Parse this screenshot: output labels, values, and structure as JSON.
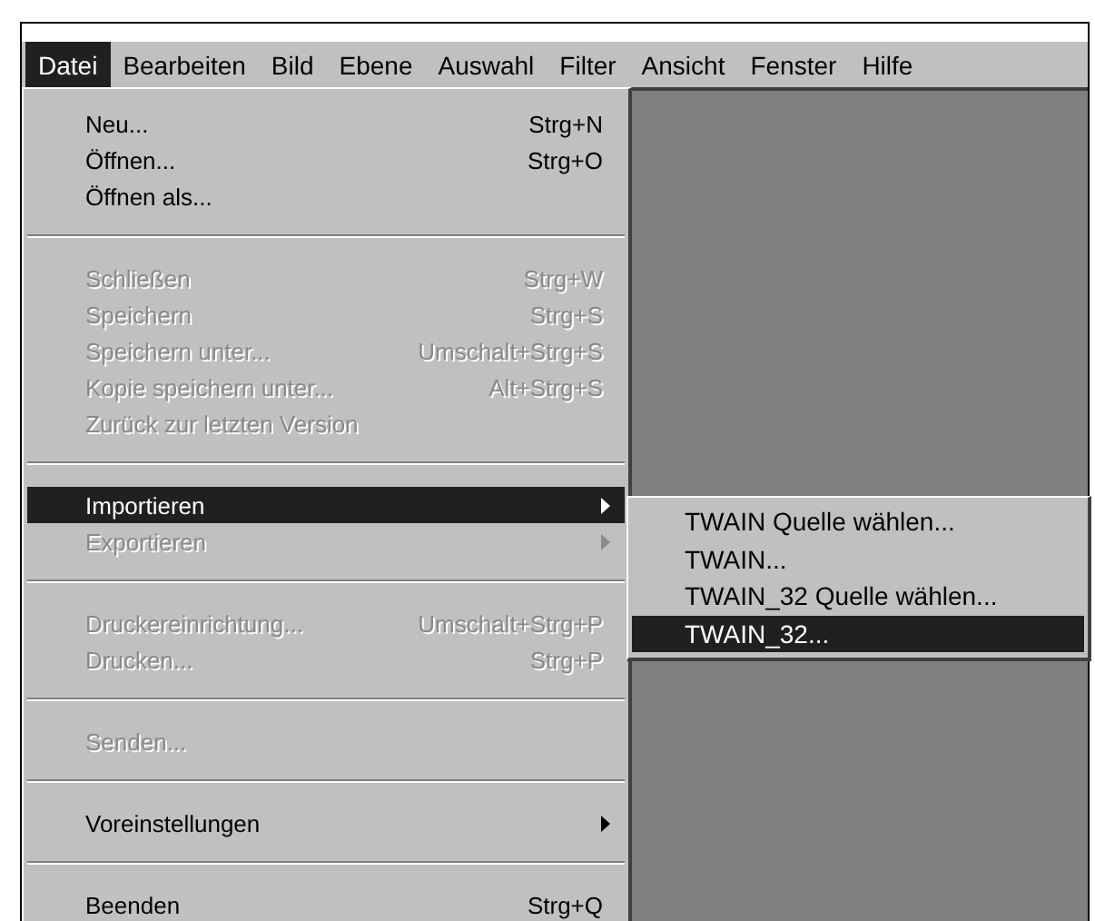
{
  "menubar": [
    {
      "label": "Datei",
      "selected": true
    },
    {
      "label": "Bearbeiten",
      "selected": false
    },
    {
      "label": "Bild",
      "selected": false
    },
    {
      "label": "Ebene",
      "selected": false
    },
    {
      "label": "Auswahl",
      "selected": false
    },
    {
      "label": "Filter",
      "selected": false
    },
    {
      "label": "Ansicht",
      "selected": false
    },
    {
      "label": "Fenster",
      "selected": false
    },
    {
      "label": "Hilfe",
      "selected": false
    }
  ],
  "menu": {
    "groups": [
      [
        {
          "label": "Neu...",
          "shortcut": "Strg+N",
          "disabled": false,
          "selected": false
        },
        {
          "label": "Öffnen...",
          "shortcut": "Strg+O",
          "disabled": false,
          "selected": false
        },
        {
          "label": "Öffnen als...",
          "disabled": false,
          "selected": false
        }
      ],
      [
        {
          "label": "Schließen",
          "shortcut": "Strg+W",
          "disabled": true,
          "selected": false
        },
        {
          "label": "Speichern",
          "shortcut": "Strg+S",
          "disabled": true,
          "selected": false
        },
        {
          "label": "Speichern unter...",
          "shortcut": "Umschalt+Strg+S",
          "disabled": true,
          "selected": false
        },
        {
          "label": "Kopie speichern unter...",
          "shortcut": "Alt+Strg+S",
          "disabled": true,
          "selected": false
        },
        {
          "label": "Zurück zur letzten Version",
          "disabled": true,
          "selected": false
        }
      ],
      [
        {
          "label": "Importieren",
          "disabled": false,
          "selected": true,
          "submenu": true
        },
        {
          "label": "Exportieren",
          "disabled": true,
          "selected": false,
          "submenu": true
        }
      ],
      [
        {
          "label": "Druckereinrichtung...",
          "shortcut": "Umschalt+Strg+P",
          "disabled": true,
          "selected": false
        },
        {
          "label": "Drucken...",
          "shortcut": "Strg+P",
          "disabled": true,
          "selected": false
        }
      ],
      [
        {
          "label": "Senden...",
          "disabled": true,
          "selected": false
        }
      ],
      [
        {
          "label": "Voreinstellungen",
          "disabled": false,
          "selected": false,
          "submenu": true
        }
      ],
      [
        {
          "label": "Beenden",
          "shortcut": "Strg+Q",
          "disabled": false,
          "selected": false
        }
      ]
    ]
  },
  "submenu": [
    {
      "label": "TWAIN Quelle wählen...",
      "selected": false
    },
    {
      "label": "TWAIN...",
      "selected": false
    },
    {
      "label": "TWAIN_32 Quelle wählen...",
      "selected": false
    },
    {
      "label": "TWAIN_32...",
      "selected": true
    }
  ]
}
